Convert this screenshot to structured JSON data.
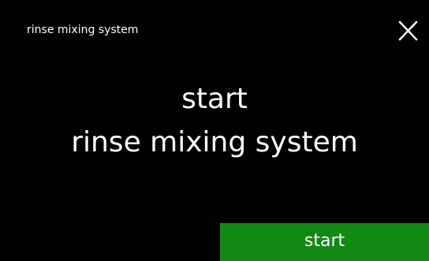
{
  "header": {
    "title": "rinse mixing system",
    "close_icon": "close-icon"
  },
  "main": {
    "line1": "start",
    "line2": "rinse mixing system"
  },
  "footer": {
    "start_label": "start"
  },
  "colors": {
    "background": "#000000",
    "text": "#ffffff",
    "start_button": "#118a13"
  }
}
